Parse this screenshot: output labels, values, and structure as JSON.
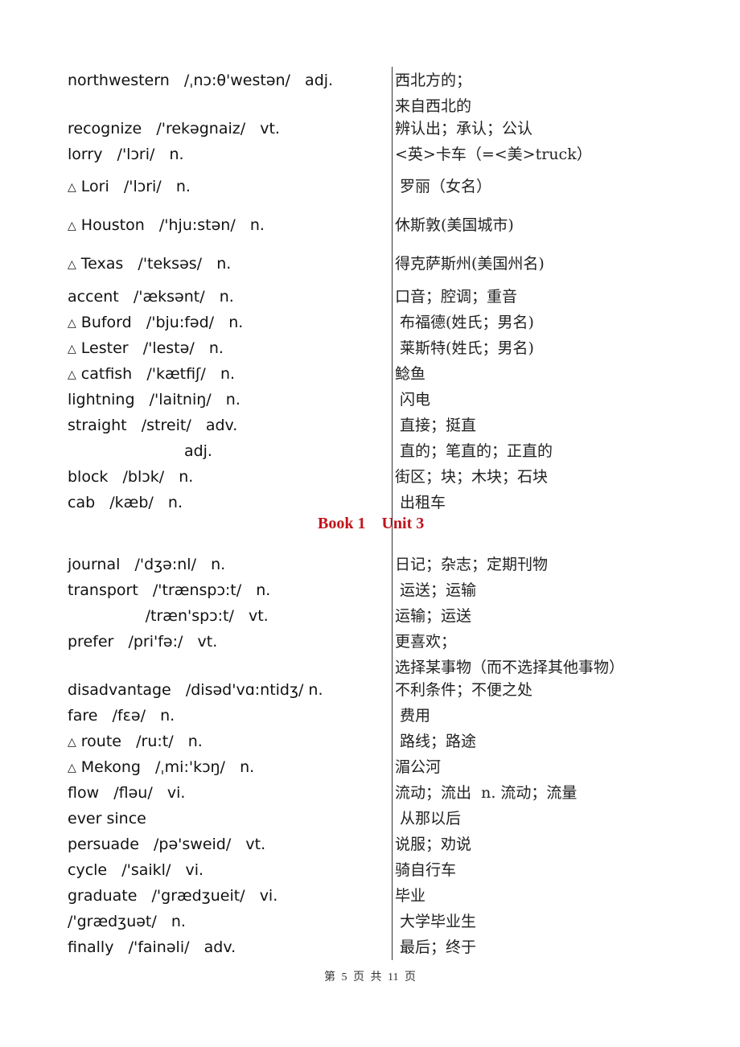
{
  "document": {
    "section_heading": "Book 1    Unit 3",
    "footer": "第 5 页 共 11 页"
  },
  "entries": [
    {
      "marked": false,
      "en": "northwestern   /ˌnɔ:θ'westən/   adj.",
      "zh": "西北方的；"
    },
    {
      "marked": false,
      "en": "",
      "zh": "来自西北的"
    },
    {
      "marked": false,
      "en": "recognize   /'rekəgnaiz/   vt.",
      "zh": "辨认出；承认；公认"
    },
    {
      "marked": false,
      "en": "lorry   /'lɔri/   n.",
      "zh": "<英>卡车（=<美>truck）"
    },
    {
      "marked": true,
      "en": "Lori   /'lɔri/   n.",
      "zh": " 罗丽（女名）"
    },
    {
      "marked": true,
      "en": "Houston   /'hju:stən/   n.",
      "zh": "休斯敦(美国城市)"
    },
    {
      "marked": true,
      "en": "Texas   /'teksəs/   n.",
      "zh": "得克萨斯州(美国州名)"
    },
    {
      "marked": false,
      "en": "accent   /'æksənt/   n.",
      "zh": "口音；腔调；重音"
    },
    {
      "marked": true,
      "en": "Buford   /'bju:fəd/   n.",
      "zh": " 布福德(姓氏；男名)"
    },
    {
      "marked": true,
      "en": "Lester   /'lestə/   n.",
      "zh": " 莱斯特(姓氏；男名)"
    },
    {
      "marked": true,
      "en": "catfish   /'kætfiʃ/   n.",
      "zh": "鲶鱼"
    },
    {
      "marked": false,
      "en": "lightning   /'laitniŋ/   n.",
      "zh": " 闪电"
    },
    {
      "marked": false,
      "en": "straight   /streit/   adv.",
      "zh": " 直接；挺直"
    },
    {
      "marked": false,
      "en": "                        adj.",
      "zh": " 直的；笔直的；正直的"
    },
    {
      "marked": false,
      "en": "block   /blɔk/   n.",
      "zh": "街区；块；木块；石块"
    },
    {
      "marked": false,
      "en": "cab   /kæb/   n.",
      "zh": " 出租车"
    },
    {
      "marked": false,
      "en": "journal   /'dʒə:nl/   n.",
      "zh": "日记；杂志；定期刊物"
    },
    {
      "marked": false,
      "en": "transport   /'trænspɔ:t/   n.",
      "zh": " 运送；运输"
    },
    {
      "marked": false,
      "en": "                /træn'spɔ:t/   vt.",
      "zh": "运输；运送"
    },
    {
      "marked": false,
      "en": "prefer   /pri'fə:/   vt.",
      "zh": "更喜欢；"
    },
    {
      "marked": false,
      "en": "",
      "zh": "选择某事物（而不选择其他事物）"
    },
    {
      "marked": false,
      "en": "disadvantage   /disəd'vɑ:ntidʒ/ n.",
      "zh": "不利条件；不便之处"
    },
    {
      "marked": false,
      "en": "fare   /fɛə/   n.",
      "zh": " 费用"
    },
    {
      "marked": true,
      "en": "route   /ru:t/   n.",
      "zh": " 路线；路途"
    },
    {
      "marked": true,
      "en": "Mekong   /ˌmi:'kɔŋ/   n.",
      "zh": "湄公河"
    },
    {
      "marked": false,
      "en": "flow   /fləu/   vi.",
      "zh": "流动；流出  n. 流动；流量"
    },
    {
      "marked": false,
      "en": "ever since",
      "zh": " 从那以后"
    },
    {
      "marked": false,
      "en": "persuade   /pə'sweid/   vt.",
      "zh": "说服；劝说"
    },
    {
      "marked": false,
      "en": "cycle   /'saikl/   vi.",
      "zh": "骑自行车"
    },
    {
      "marked": false,
      "en": "graduate   /'grædʒueit/   vi.",
      "zh": "毕业"
    },
    {
      "marked": false,
      "en": "/'grædʒuət/   n.",
      "zh": " 大学毕业生"
    },
    {
      "marked": false,
      "en": "finally   /'fainəli/   adv.",
      "zh": " 最后；终于"
    }
  ],
  "icons": {
    "marker_glyph": "△"
  }
}
